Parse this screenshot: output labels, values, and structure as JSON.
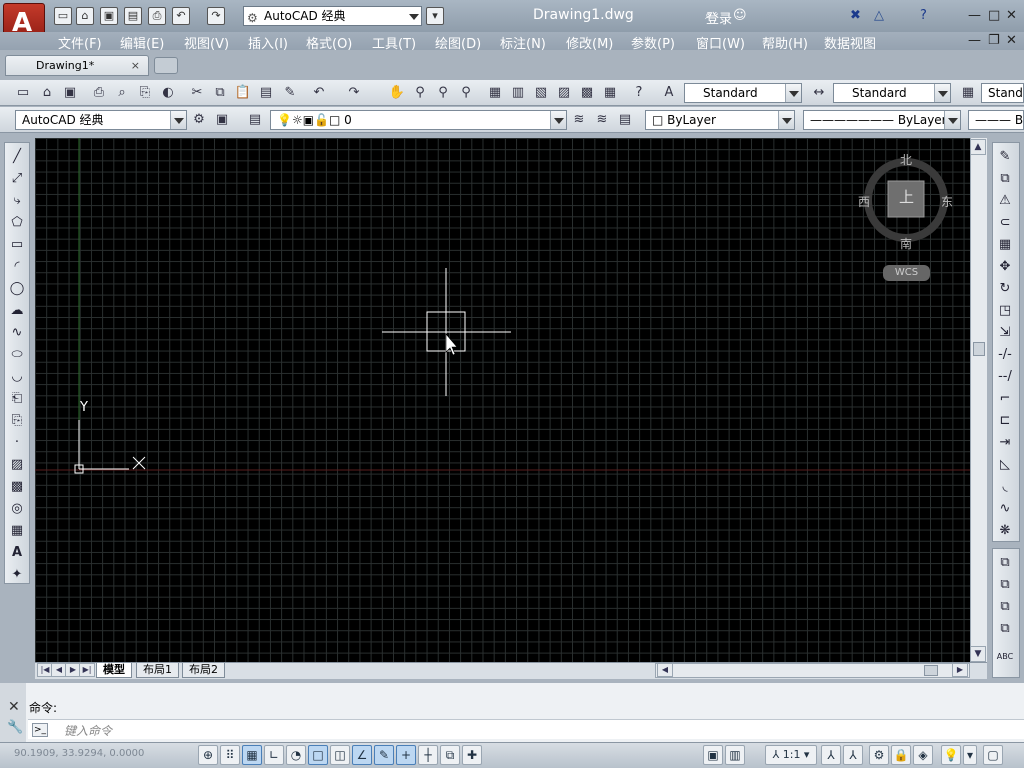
{
  "app": {
    "title": "Drawing1.dwg",
    "login": "登录"
  },
  "workspace": {
    "quick_combo": "AutoCAD 经典",
    "toolbar_combo": "AutoCAD 经典"
  },
  "menus": [
    "文件(F)",
    "编辑(E)",
    "视图(V)",
    "插入(I)",
    "格式(O)",
    "工具(T)",
    "绘图(D)",
    "标注(N)",
    "修改(M)",
    "参数(P)",
    "窗口(W)",
    "帮助(H)",
    "数据视图"
  ],
  "doc_tab": {
    "label": "Drawing1*",
    "close": "×"
  },
  "styles": {
    "text_style": "Standard",
    "dim_style": "Standard",
    "table_style": "Standa"
  },
  "layer": {
    "current": "0"
  },
  "properties": {
    "color": "ByLayer",
    "linetype": "ByLayer",
    "lineweight": "B"
  },
  "viewcube": {
    "top": "上",
    "north": "北",
    "south": "南",
    "east": "东",
    "west": "西",
    "wcs": "WCS"
  },
  "ucs": {
    "x": "X",
    "y": "Y"
  },
  "layout_tabs": [
    "模型",
    "布局1",
    "布局2"
  ],
  "command": {
    "history": "命令:",
    "placeholder": "键入命令"
  },
  "status": {
    "coords": "90.1909,  33.9294, 0.0000",
    "annotation_scale": "1:1"
  },
  "colors": {
    "canvas": "#000000",
    "grid": "#2a2f2f",
    "accent_red": "#c43a2a"
  }
}
